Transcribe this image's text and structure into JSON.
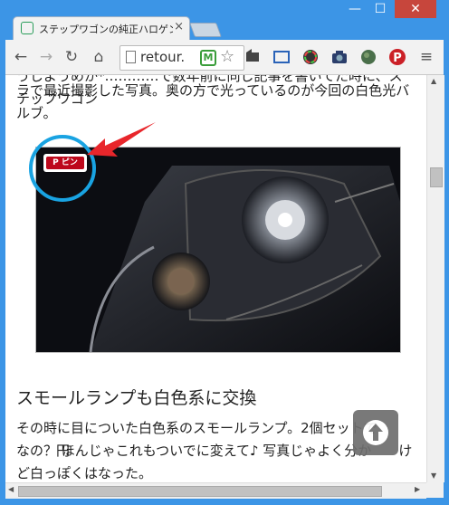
{
  "window": {
    "tab_title": "ステップワゴンの純正ハロゲン/",
    "tab_close": "×",
    "minimize": "—",
    "maximize": "☐",
    "close": "✕"
  },
  "toolbar": {
    "url": "retour.",
    "ext_badge": "M"
  },
  "content": {
    "para1_line1": "うじようめか*…………で数年前に同じ記事を書いてた時に、ステップワゴン",
    "para1_line2": "ラで最近撮影した写真。奥の方で光っているのが今回の白色光バ",
    "para1_line3": "ルブ。",
    "pin_label": "P ピン",
    "heading": "スモールランプも白色系に交換",
    "para2_line1": "その時に目についた白色系のスモールランプ。2個セットで",
    "para2_line1_end": "円",
    "para2_line2": "なの？ ほんじゃこれもついでに変えて♪ 写真じゃよく分か",
    "para2_line2_end": "け",
    "para2_line3": "ど白っぽくはなった。"
  },
  "colors": {
    "window_frame": "#3c95e6",
    "pin_red": "#bd081c",
    "highlight_circle": "#19a3e2",
    "arrow_red": "#e8262b",
    "close_button": "#c7463c"
  },
  "icons": [
    "back-icon",
    "forward-icon",
    "reload-icon",
    "home-icon",
    "page-icon",
    "star-icon",
    "film-icon",
    "screen-capture-icon",
    "color-wheel-icon",
    "camera-icon",
    "globe-icon",
    "pinterest-icon",
    "menu-icon",
    "arrow-up-icon"
  ]
}
